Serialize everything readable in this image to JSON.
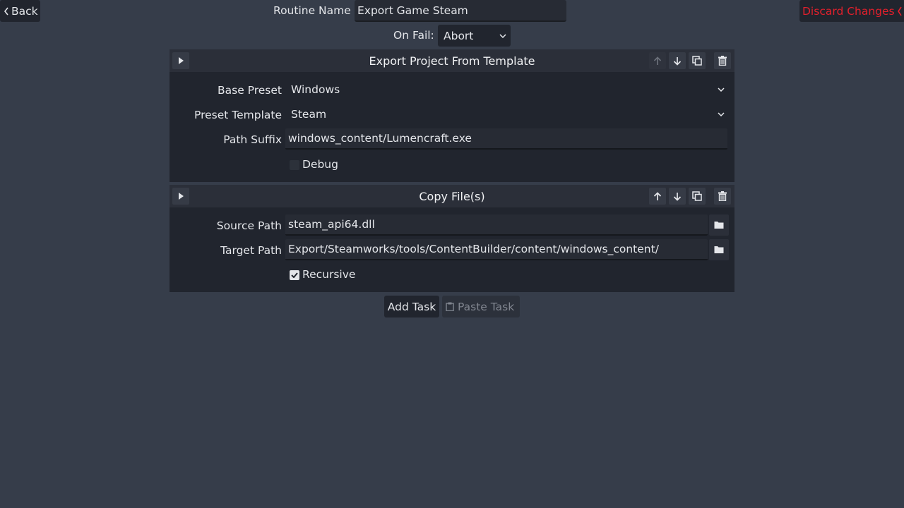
{
  "header": {
    "back_label": "Back",
    "routine_name_label": "Routine Name",
    "routine_name_value": "Export Game Steam",
    "discard_label": "Discard Changes",
    "on_fail_label": "On Fail:",
    "on_fail_value": "Abort"
  },
  "tasks": [
    {
      "title": "Export Project From Template",
      "fields": {
        "base_preset_label": "Base Preset",
        "base_preset_value": "Windows",
        "preset_template_label": "Preset Template",
        "preset_template_value": "Steam",
        "path_suffix_label": "Path Suffix",
        "path_suffix_value": "windows_content/Lumencraft.exe",
        "debug_label": "Debug",
        "debug_checked": false
      },
      "move_up_enabled": false
    },
    {
      "title": "Copy File(s)",
      "fields": {
        "source_path_label": "Source Path",
        "source_path_value": "steam_api64.dll",
        "target_path_label": "Target Path",
        "target_path_value": "Export/Steamworks/tools/ContentBuilder/content/windows_content/",
        "recursive_label": "Recursive",
        "recursive_checked": true
      },
      "move_up_enabled": true
    }
  ],
  "footer": {
    "add_task_label": "Add Task",
    "paste_task_label": "Paste Task",
    "paste_enabled": false
  },
  "colors": {
    "background": "#363d4a",
    "panel": "#21252e",
    "discard_accent": "#e2202c",
    "text": "#e4e6ea",
    "disabled_text": "#80858f"
  },
  "icons": {
    "back": "chevron-left-icon",
    "discard": "chevron-left-icon",
    "play": "play-icon",
    "up": "arrow-up-icon",
    "down": "arrow-down-icon",
    "duplicate": "duplicate-icon",
    "delete": "trash-icon",
    "folder": "folder-icon",
    "dropdown": "chevron-down-icon",
    "paste": "clipboard-icon"
  }
}
